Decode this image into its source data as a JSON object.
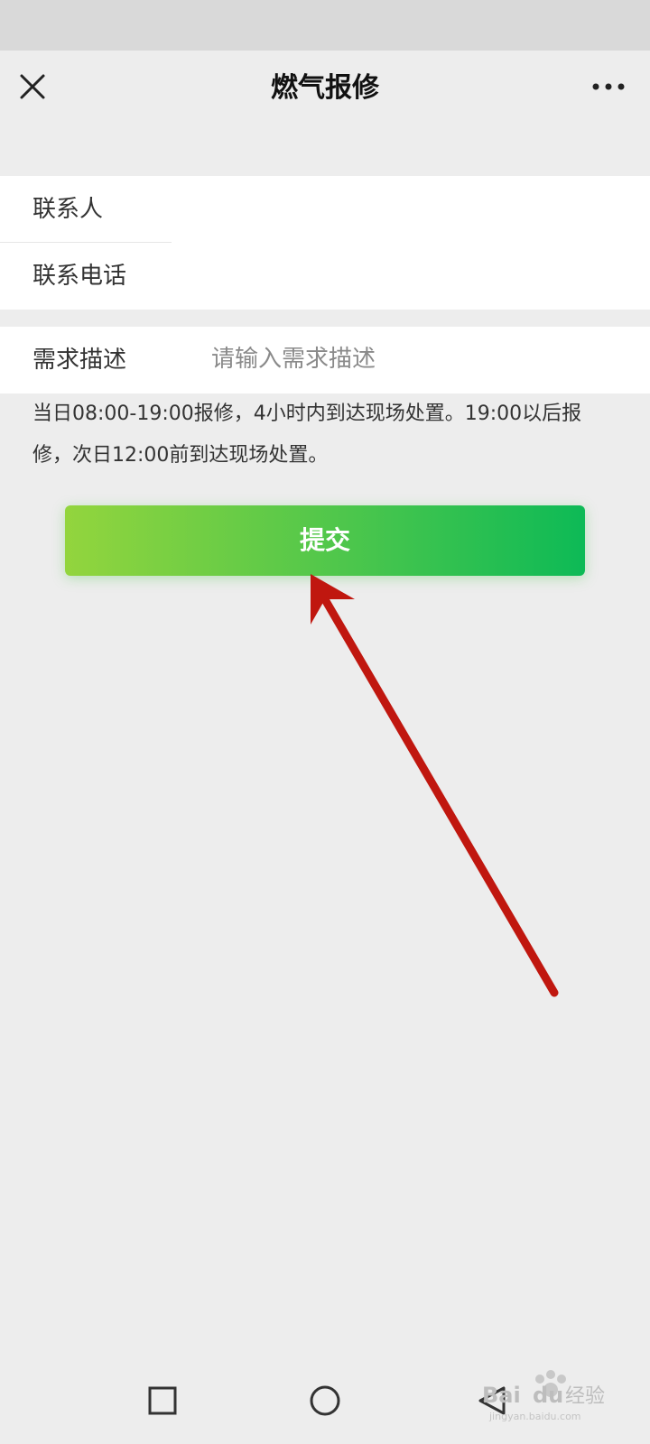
{
  "header": {
    "title": "燃气报修",
    "close_icon": "close-icon",
    "more_icon": "more-dots-icon"
  },
  "form": {
    "contact_label": "联系人",
    "phone_label": "联系电话",
    "description_label": "需求描述",
    "description_placeholder": "请输入需求描述"
  },
  "notice": "当日08:00-19:00报修，4小时内到达现场处置。19:00以后报修，次日12:00前到达现场处置。",
  "submit_label": "提交",
  "colors": {
    "button_gradient_start": "#93d53d",
    "button_gradient_end": "#0dba56",
    "annotation_arrow": "#c0170f",
    "page_background": "#ededed"
  },
  "system_nav": {
    "recent_icon": "square-icon",
    "home_icon": "circle-icon",
    "back_icon": "triangle-back-icon"
  },
  "watermark": {
    "logo": "baidu-jingyan-logo",
    "text": "Bai du 经验",
    "url": "jingyan.baidu.com"
  }
}
